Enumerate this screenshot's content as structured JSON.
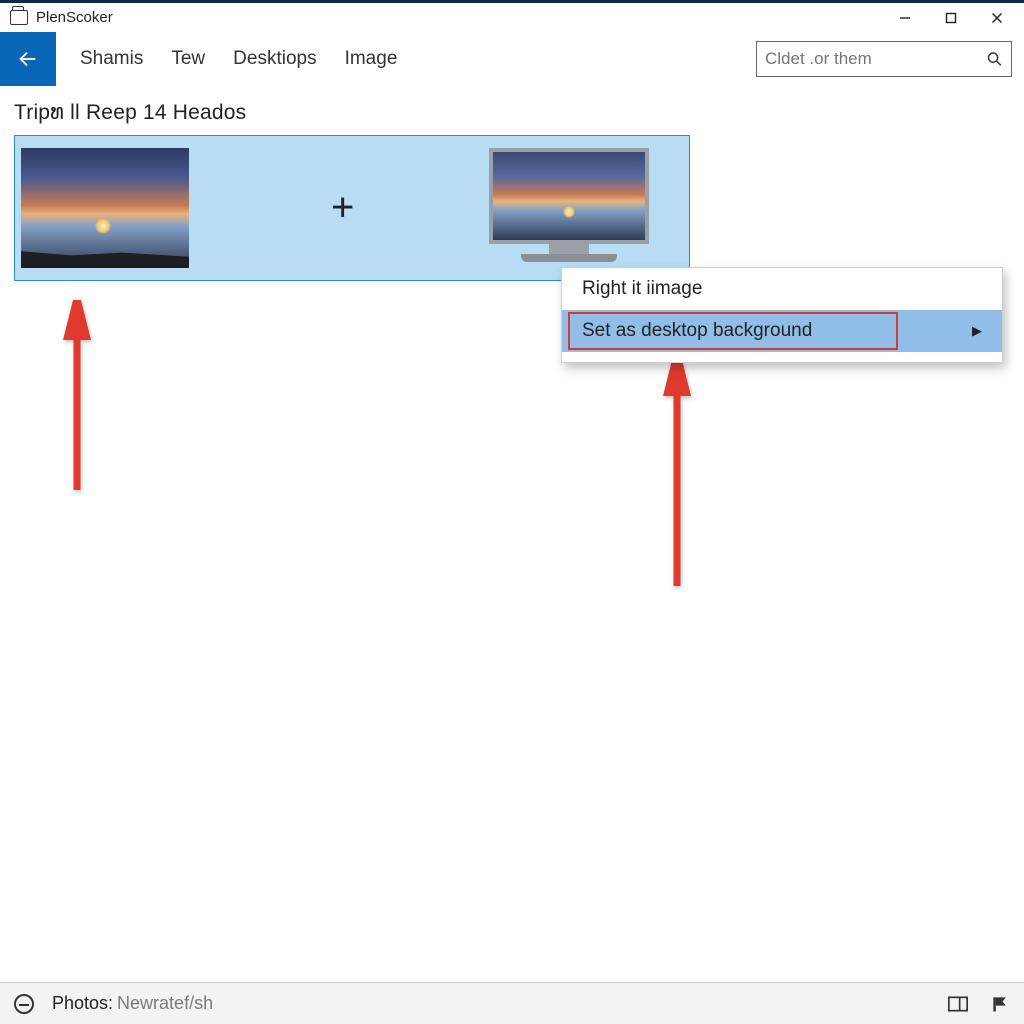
{
  "titlebar": {
    "app_title": "PlenScoker"
  },
  "toolbar": {
    "menu": [
      "Shamis",
      "Tew",
      "Desktiops",
      "Image"
    ],
    "search_placeholder": "Cldet .or them"
  },
  "heading": "Tripທ ll Reep 14 Heados",
  "context_menu": {
    "items": [
      {
        "label": "Right it iimage",
        "highlighted": false
      },
      {
        "label": "Set as desktop background",
        "highlighted": true,
        "has_submenu": true
      }
    ]
  },
  "statusbar": {
    "label": "Photos:",
    "value": "Newratef/sh"
  }
}
